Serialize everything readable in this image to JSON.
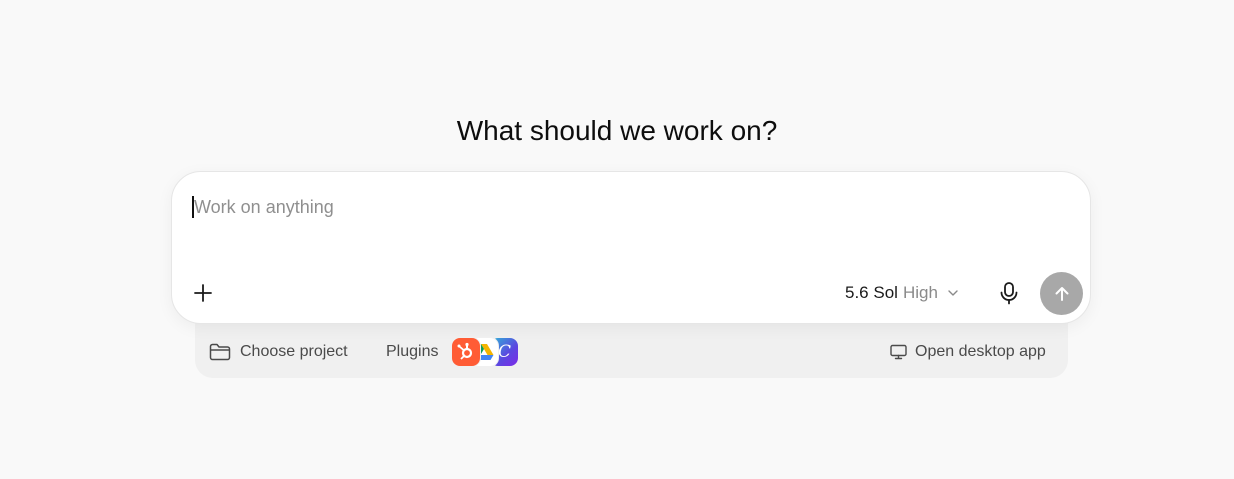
{
  "heading": "What should we work on?",
  "composer": {
    "placeholder": "Work on anything",
    "value": "",
    "model_name": "5.6 Sol",
    "model_level": "High"
  },
  "footer": {
    "choose_project_label": "Choose project",
    "plugins_label": "Plugins",
    "plugin_icons": [
      "hubspot-icon",
      "google-drive-icon",
      "canva-icon"
    ],
    "canva_glyph": "C",
    "open_desktop_label": "Open desktop app"
  },
  "colors": {
    "background": "#f9f9f9",
    "send_button": "#a8a8a8",
    "hubspot": "#ff5c35",
    "footer_bar": "#f0f0f0"
  }
}
